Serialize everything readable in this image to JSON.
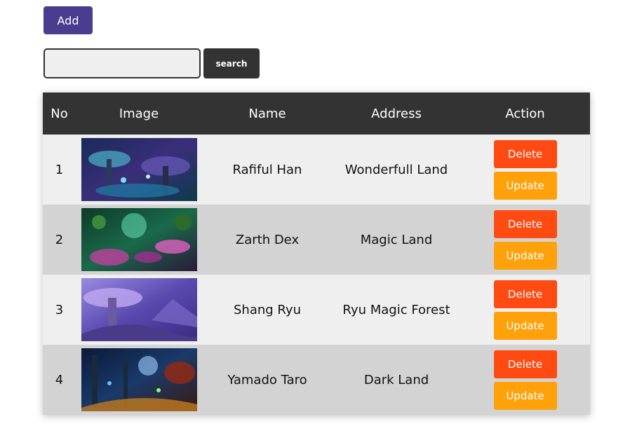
{
  "toolbar": {
    "add_label": "Add",
    "search_label": "search",
    "search_value": "",
    "search_placeholder": ""
  },
  "table": {
    "headers": [
      "No",
      "Image",
      "Name",
      "Address",
      "Action"
    ],
    "rows": [
      {
        "no": "1",
        "name": "Rafiful Han",
        "address": "Wonderfull Land",
        "image_icon": "fantasy-forest-image"
      },
      {
        "no": "2",
        "name": "Zarth Dex",
        "address": "Magic Land",
        "image_icon": "mushroom-land-image"
      },
      {
        "no": "3",
        "name": "Shang Ryu",
        "address": "Ryu Magic Forest",
        "image_icon": "purple-mushroom-image"
      },
      {
        "no": "4",
        "name": "Yamado Taro",
        "address": "Dark Land",
        "image_icon": "dark-forest-image"
      }
    ],
    "delete_label": "Delete",
    "update_label": "Update"
  },
  "colors": {
    "add_button": "#4a3d8f",
    "header_bg": "#333333",
    "delete_button": "#ff4a12",
    "update_button": "#ffa10a",
    "row_odd": "#efefef",
    "row_even": "#d3d3d3"
  }
}
